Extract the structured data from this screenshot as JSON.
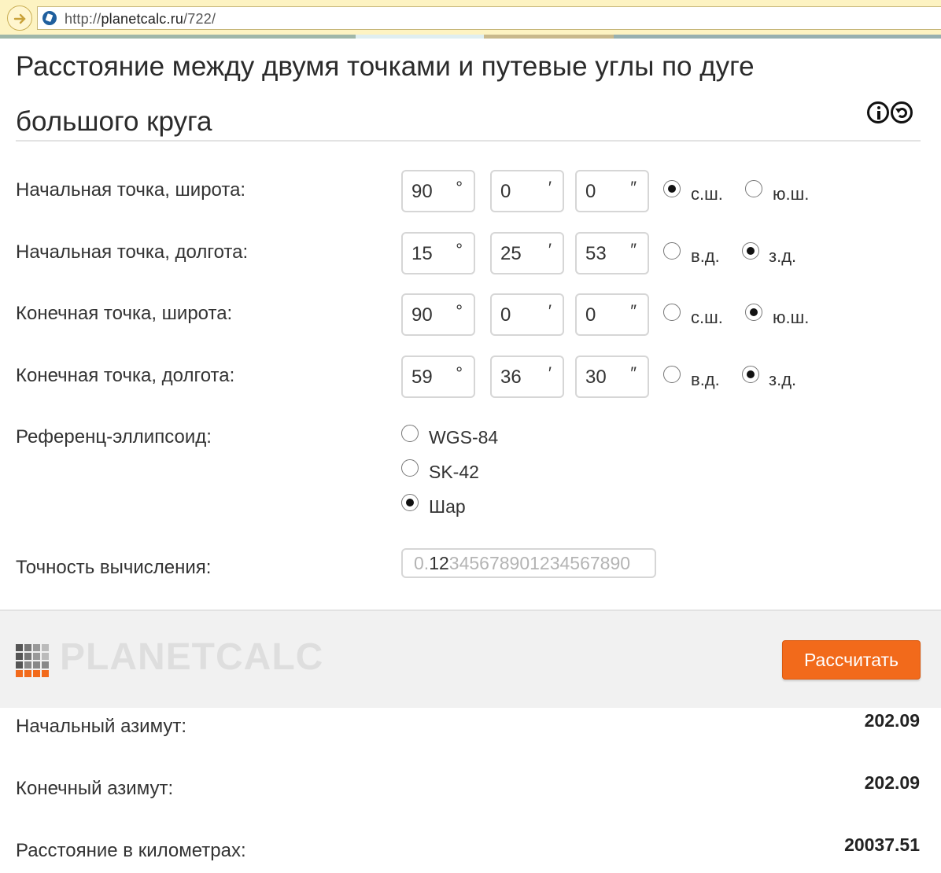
{
  "browser": {
    "url_prefix": "http://",
    "url_domain": "planetcalc.ru",
    "url_path": "/722/"
  },
  "page": {
    "title": "Расстояние между двумя точками и путевые углы по дуге большого круга"
  },
  "inputs": [
    {
      "label": "Начальная точка, широта:",
      "deg": "90",
      "min": "0",
      "sec": "0",
      "opt1": "с.ш.",
      "opt2": "ю.ш.",
      "selected": 1
    },
    {
      "label": "Начальная точка, долгота:",
      "deg": "15",
      "min": "25",
      "sec": "53",
      "opt1": "в.д.",
      "opt2": "з.д.",
      "selected": 2
    },
    {
      "label": "Конечная точка, широта:",
      "deg": "90",
      "min": "0",
      "sec": "0",
      "opt1": "с.ш.",
      "opt2": "ю.ш.",
      "selected": 2
    },
    {
      "label": "Конечная точка, долгота:",
      "deg": "59",
      "min": "36",
      "sec": "30",
      "opt1": "в.д.",
      "opt2": "з.д.",
      "selected": 2
    }
  ],
  "units": {
    "deg": "°",
    "min": "′",
    "sec": "″"
  },
  "ellipsoid": {
    "label": "Референц-эллипсоид:",
    "options": [
      "WGS-84",
      "SK-42",
      "Шар"
    ],
    "selected": 2
  },
  "precision": {
    "label": "Точность вычисления:",
    "prefix": "0.",
    "active": "12",
    "rest": "34567890123456789 0"
  },
  "brand": {
    "name": "PLANETCALC"
  },
  "calculate_label": "Рассчитать",
  "results": [
    {
      "label": "Начальный азимут:",
      "value": "202.09"
    },
    {
      "label": "Конечный азимут:",
      "value": "202.09"
    },
    {
      "label": "Расстояние в километрах:",
      "value": "20037.51"
    }
  ],
  "colors": {
    "accent": "#f26a1b",
    "address_bar": "#fdf3c2",
    "band": "#f1f1f1"
  }
}
